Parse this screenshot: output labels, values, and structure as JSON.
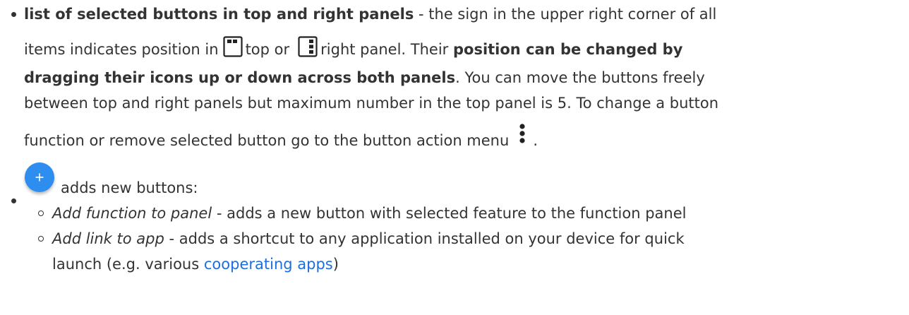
{
  "item1": {
    "bold_title": "list of selected buttons in top and right panels",
    "line1_rest": " - the sign in the upper right corner of all",
    "line2_a": "items indicates position in",
    "line2_b": "top or",
    "line2_c": "right panel. Their ",
    "line2_bold": "position can be changed by",
    "line3_bold": "dragging their icons up or down across both panels",
    "line3_rest": ". You can move the buttons freely",
    "line4": "between top and right panels but maximum number in the top panel is 5. To change a button",
    "line5_a": "function or remove selected button go to the button action menu",
    "line5_b": ".",
    "icons": [
      "top-panel-icon",
      "right-panel-icon",
      "action-menu-icon"
    ]
  },
  "item2": {
    "text": "adds new buttons:",
    "icon": "add-fab-icon",
    "icon_color": "#2e8ef0",
    "subitems": [
      {
        "title": "Add function to panel",
        "desc": " - adds a new button with selected feature to the function panel"
      },
      {
        "title": "Add link to app",
        "desc_line1": " - adds a shortcut to any application installed on your device for quick",
        "desc_line2_a": "launch (e.g. various ",
        "link": "cooperating apps",
        "desc_line2_b": ")"
      }
    ]
  },
  "colors": {
    "text": "#333333",
    "link": "#1d6fe0"
  }
}
